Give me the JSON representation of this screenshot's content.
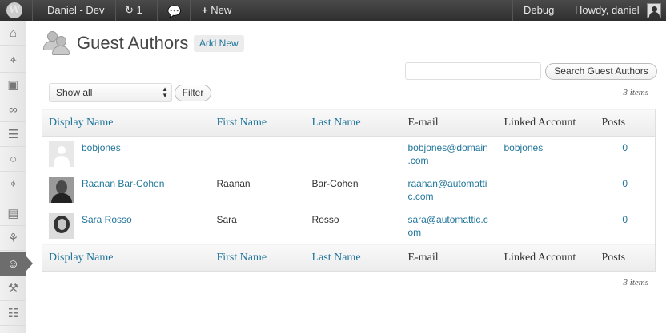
{
  "adminbar": {
    "site_name": "Daniel - Dev",
    "updates_count": "1",
    "new_label": "New",
    "debug_label": "Debug",
    "howdy": "Howdy, daniel"
  },
  "page": {
    "title": "Guest Authors",
    "add_new": "Add New"
  },
  "search": {
    "value": "",
    "button": "Search Guest Authors"
  },
  "filter": {
    "selected": "Show all",
    "button": "Filter"
  },
  "items_count": "3 items",
  "columns": [
    "Display Name",
    "First Name",
    "Last Name",
    "E-mail",
    "Linked Account",
    "Posts"
  ],
  "rows": [
    {
      "display_name": "bobjones",
      "first": "",
      "last": "",
      "email_l1": "bobjones@domain",
      "email_l2": ".com",
      "linked": "bobjones",
      "posts": "0"
    },
    {
      "display_name": "Raanan Bar-Cohen",
      "first": "Raanan",
      "last": "Bar-Cohen",
      "email_l1": "raanan@automatti",
      "email_l2": "c.com",
      "linked": "",
      "posts": "0"
    },
    {
      "display_name": "Sara Rosso",
      "first": "Sara",
      "last": "Rosso",
      "email_l1": "sara@automattic.c",
      "email_l2": "om",
      "linked": "",
      "posts": "0"
    }
  ],
  "colors": {
    "link": "#21759b",
    "adminbar": "#3a3a3a"
  }
}
